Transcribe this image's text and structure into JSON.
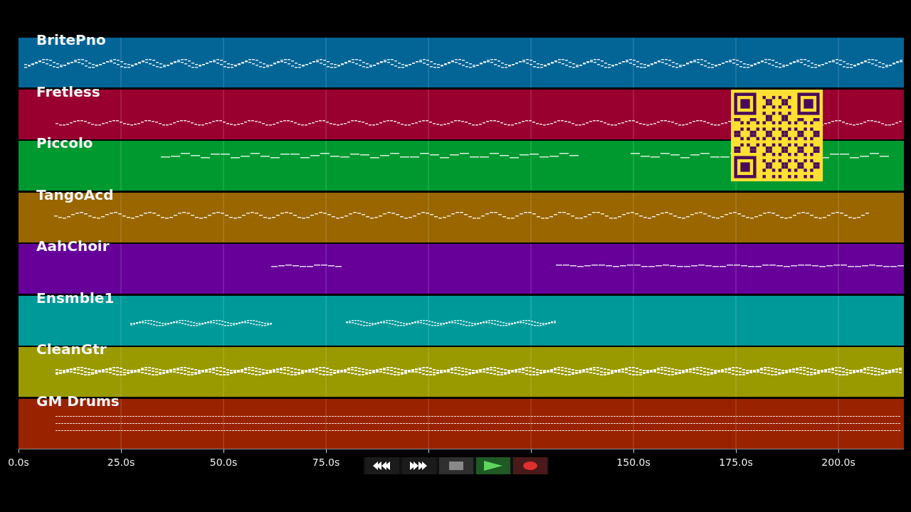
{
  "tracks": [
    {
      "name": "BritePno",
      "color": "#036496"
    },
    {
      "name": "Fretless",
      "color": "#990030"
    },
    {
      "name": "Piccolo",
      "color": "#009930"
    },
    {
      "name": "TangoAcd",
      "color": "#996600"
    },
    {
      "name": "AahChoir",
      "color": "#660099"
    },
    {
      "name": "Ensmble1",
      "color": "#009999"
    },
    {
      "name": "CleanGtr",
      "color": "#999900"
    },
    {
      "name": "GM Drums",
      "color": "#992200"
    }
  ],
  "time_axis": {
    "ticks": [
      {
        "kind": "labeled",
        "label": "0.0s"
      },
      {
        "kind": "labeled",
        "label": "25.0s"
      },
      {
        "kind": "labeled",
        "label": "50.0s"
      },
      {
        "kind": "labeled",
        "label": "75.0s"
      },
      {
        "kind": "bare"
      },
      {
        "kind": "bare"
      },
      {
        "kind": "labeled",
        "label": "150.0s"
      },
      {
        "kind": "labeled",
        "label": "175.0s"
      },
      {
        "kind": "labeled",
        "label": "200.0s"
      }
    ]
  },
  "transport": [
    {
      "kind": "rewind"
    },
    {
      "kind": "forward"
    },
    {
      "kind": "stop"
    },
    {
      "kind": "play"
    },
    {
      "kind": "record"
    }
  ]
}
